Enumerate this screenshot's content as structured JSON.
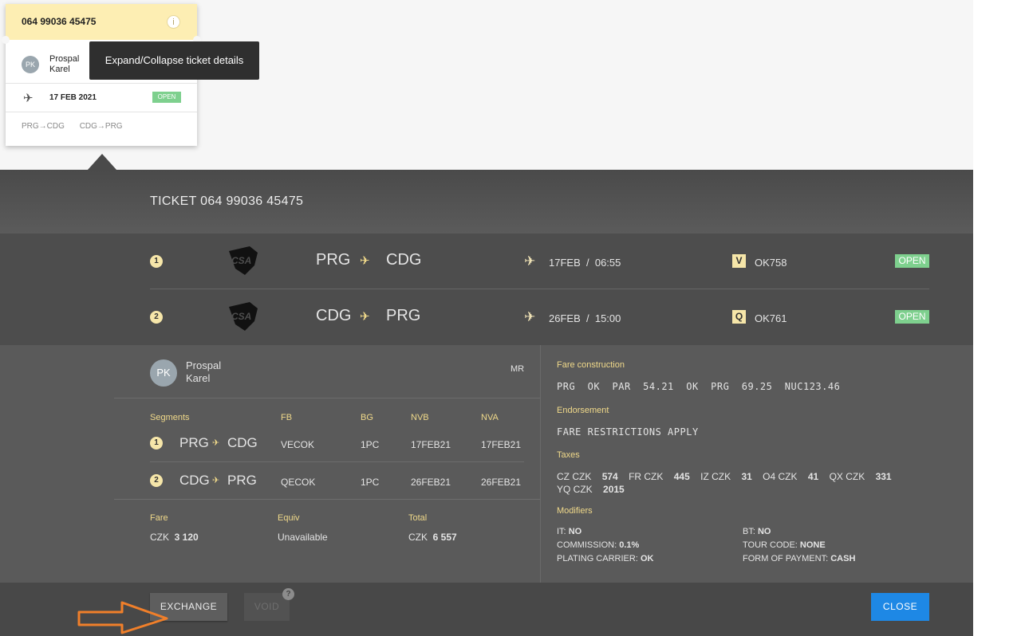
{
  "ticket_card": {
    "number": "064 99036 45475",
    "info_icon": "i",
    "avatar": "PK",
    "name_first": "Prospal",
    "name_last": "Karel",
    "date": "17 FEB 2021",
    "status": "OPEN",
    "routes": [
      "PRG→CDG",
      "CDG→PRG"
    ]
  },
  "tooltip": "Expand/Collapse ticket details",
  "panel": {
    "title": "TICKET 064 99036 45475",
    "segments": [
      {
        "num": "1",
        "from": "PRG",
        "to": "CDG",
        "date": "17FEB",
        "sep": "/",
        "time": "06:55",
        "class": "V",
        "flight": "OK758",
        "status": "OPEN"
      },
      {
        "num": "2",
        "from": "CDG",
        "to": "PRG",
        "date": "26FEB",
        "sep": "/",
        "time": "15:00",
        "class": "Q",
        "flight": "OK761",
        "status": "OPEN"
      }
    ],
    "airline_logo_text": "CSA"
  },
  "passenger": {
    "avatar": "PK",
    "first": "Prospal",
    "last": "Karel",
    "type": "MR"
  },
  "segment_table": {
    "headers": {
      "segments": "Segments",
      "fb": "FB",
      "bg": "BG",
      "nvb": "NVB",
      "nva": "NVA"
    },
    "rows": [
      {
        "num": "1",
        "from": "PRG",
        "to": "CDG",
        "fb": "VECOK",
        "bg": "1PC",
        "nvb": "17FEB21",
        "nva": "17FEB21"
      },
      {
        "num": "2",
        "from": "CDG",
        "to": "PRG",
        "fb": "QECOK",
        "bg": "1PC",
        "nvb": "26FEB21",
        "nva": "26FEB21"
      }
    ]
  },
  "fare": {
    "fare_label": "Fare",
    "fare_currency": "CZK",
    "fare_amount": "3 120",
    "equiv_label": "Equiv",
    "equiv_value": "Unavailable",
    "total_label": "Total",
    "total_currency": "CZK",
    "total_amount": "6 557"
  },
  "fare_info": {
    "construction_label": "Fare construction",
    "construction": "PRG  OK  PAR  54.21  OK  PRG  69.25  NUC123.46",
    "endorsement_label": "Endorsement",
    "endorsement": "FARE RESTRICTIONS APPLY",
    "taxes_label": "Taxes",
    "taxes": [
      {
        "code": "CZ CZK",
        "amount": "574"
      },
      {
        "code": "FR CZK",
        "amount": "445"
      },
      {
        "code": "IZ CZK",
        "amount": "31"
      },
      {
        "code": "O4 CZK",
        "amount": "41"
      },
      {
        "code": "QX CZK",
        "amount": "331"
      },
      {
        "code": "YQ CZK",
        "amount": "2015"
      }
    ],
    "modifiers_label": "Modifiers",
    "modifiers": {
      "it_label": "IT:",
      "it": "NO",
      "bt_label": "BT:",
      "bt": "NO",
      "commission_label": "COMMISSION:",
      "commission": "0.1%",
      "tour_label": "TOUR CODE:",
      "tour": "NONE",
      "carrier_label": "PLATING CARRIER:",
      "carrier": "OK",
      "fop_label": "FORM OF PAYMENT:",
      "fop": "CASH"
    }
  },
  "footer": {
    "exchange": "EXCHANGE",
    "void": "VOID",
    "void_help": "?",
    "close": "CLOSE"
  },
  "colors": {
    "accent": "#1e88e5",
    "open": "#7ed08e",
    "highlight": "#f6e6a9",
    "annotation_arrow": "#f07f2a"
  }
}
